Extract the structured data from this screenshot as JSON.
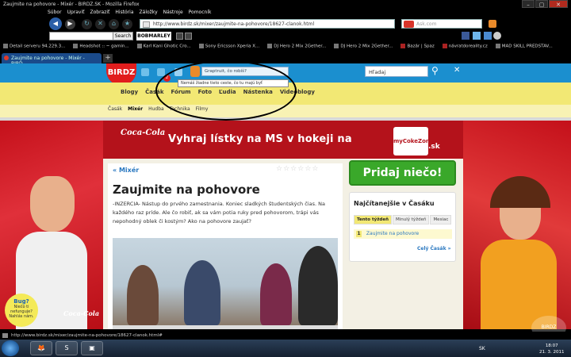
{
  "window": {
    "title": "Zaujmite na pohovore - Mixér - BIRDZ.SK - Mozilla Firefox",
    "controls": [
      "–",
      "▢",
      "✕"
    ]
  },
  "menu": [
    "Súbor",
    "Upraviť",
    "Zobraziť",
    "História",
    "Záložky",
    "Nástroje",
    "Pomocník"
  ],
  "address_bar": {
    "url": "http://www.birdz.sk/mixer/zaujmite-na-pohovore/18627-clanok.html"
  },
  "search_bar": {
    "placeholder": "Ask.com"
  },
  "toolbar": {
    "search_label": "Search",
    "brand": "BOBMARLEY"
  },
  "bookmarks": [
    "Detail serveru 94.229.3...",
    "Headshot :: ~ gamin...",
    "Karl Kani Ghotic Cro...",
    "Sony Ericsson Xperia X...",
    "DJ Hero 2 Mix 2Gether...",
    "DJ Hero 2 Mix 2Gether...",
    "Bazár | Spaz",
    "návratdoreality.cz",
    "MAD SKILL PREDSTAV..."
  ],
  "tab": {
    "label": "Zaujmite na pohovore - Mixér - BIRD..."
  },
  "birdz": {
    "logo": "BIRDZ",
    "notification_count": "2",
    "status_placeholder": "Graptruit, čo robíš?",
    "status_tooltip": "Nemáš žiadne tieto ceste, čo tu majú byť",
    "search_placeholder": "Hľadaj",
    "nav": [
      "Blogy",
      "Časák",
      "Fórum",
      "Foto",
      "Ľudia",
      "Nástenka",
      "Videoblogy"
    ],
    "subnav": [
      "Časák",
      "Mixér",
      "Hudba",
      "Technika",
      "Filmy"
    ],
    "subnav_selected": "Mixér"
  },
  "banner": {
    "brand": "Coca-Cola",
    "text": "Vyhraj lístky na MS v hokeji na",
    "zone": "myCokeZone",
    "zone_suffix": ".sk"
  },
  "article": {
    "category": "« Mixér",
    "title": "Zaujmite na pohovore",
    "lead": "-INZERCIA- Nástup do prvého zamestnania. Koniec sladkých študentských čias. Na každého raz príde. Ale čo robiť, ak sa vám potia ruky pred pohovorom, trápi vás nepohodný oblek či kostým? Ako na pohovore zaujať?"
  },
  "sidebar": {
    "pridaj_label": "Pridaj niečo!",
    "box_title": "Najčítanejšie v Časáku",
    "tabs": [
      "Tento týždeň",
      "Minulý týždeň",
      "Mesiac"
    ],
    "selected_tab": "Tento týždeň",
    "item_number": "1",
    "item_label": "Zaujmite na pohovore",
    "more_label": "Celý Časák »"
  },
  "bug_badge": {
    "title": "Bug?",
    "text": "Niečo ti nefunguje? Nahlás nám."
  },
  "ad_left_brand": "Coca-Cola",
  "watermark": "BIRDZ",
  "status_bar": {
    "text": "http://www.birdz.sk/mixer/zaujmite-na-pohovore/18627-clanok.html#"
  },
  "taskbar": {
    "lang": "SK",
    "time": "18:07",
    "date": "21. 3. 2011"
  },
  "colors": {
    "birdz_blue": "#1b8fcf",
    "birdz_red": "#e11d1d",
    "nav_yellow": "#f2e874",
    "cta_green": "#3aa82a",
    "link_blue": "#2a78c0"
  }
}
